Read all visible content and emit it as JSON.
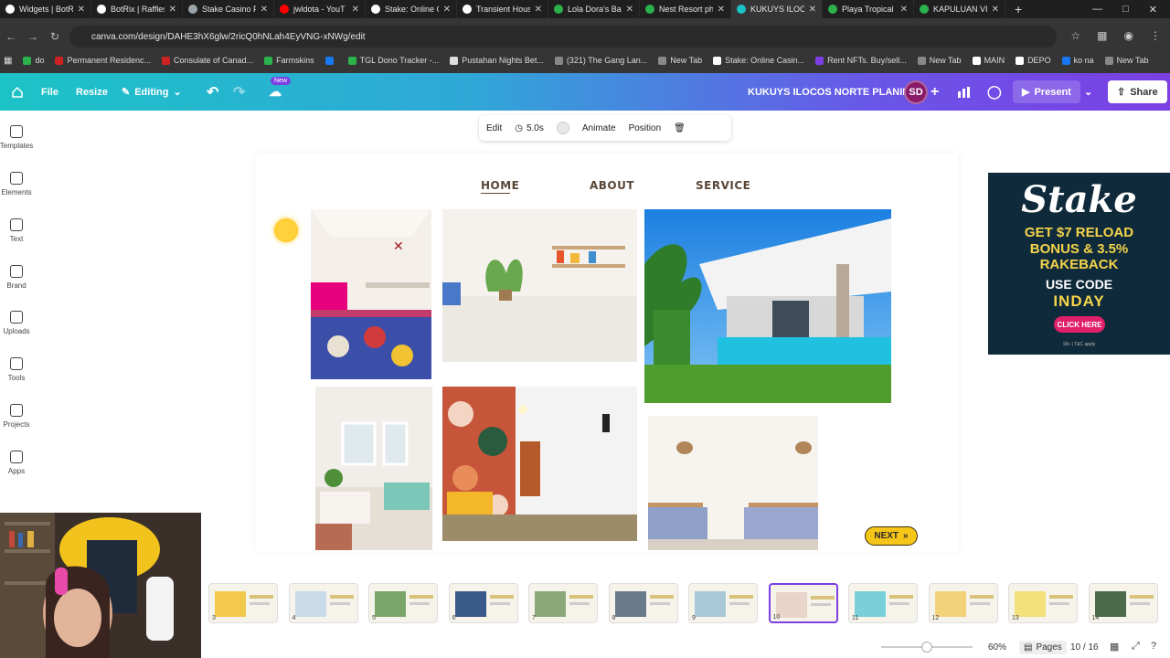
{
  "browser": {
    "tabs": [
      {
        "title": "Widgets | BotR",
        "color": "#ffffff"
      },
      {
        "title": "BotRix | Raffles",
        "color": "#ffffff"
      },
      {
        "title": "Stake Casino P",
        "color": "#9aa4a8"
      },
      {
        "title": "jwldota - YouT",
        "color": "#ff0000"
      },
      {
        "title": "Stake: Online C",
        "color": "#ffffff"
      },
      {
        "title": "Transient Hous",
        "color": "#ffffff"
      },
      {
        "title": "Lola Dora's Ba",
        "color": "#2bb24c"
      },
      {
        "title": "Nest Resort ph",
        "color": "#2bb24c"
      },
      {
        "title": "KUKUYS ILOCO",
        "color": "#1cc3c6"
      },
      {
        "title": "Playa Tropical",
        "color": "#2bb24c"
      },
      {
        "title": "KAPULUAN VI",
        "color": "#2bb24c"
      }
    ],
    "active_tab_index": 8,
    "url": "canva.com/design/DAHE3hX6glw/2ricQ0hNLah4EyVNG-xNWg/edit",
    "bookmarks": [
      {
        "label": "do",
        "color": "#2bb24c"
      },
      {
        "label": "Permanent Residenc...",
        "color": "#cc2222"
      },
      {
        "label": "Consulate of Canad...",
        "color": "#cc2222"
      },
      {
        "label": "Farmskins",
        "color": "#2bb24c"
      },
      {
        "label": "",
        "color": "#1877f2"
      },
      {
        "label": "TGL Dono Tracker -...",
        "color": "#2bb24c"
      },
      {
        "label": "Pustahan Nights Bet...",
        "color": "#dddddd"
      },
      {
        "label": "(321) The Gang Lan...",
        "color": "#888888"
      },
      {
        "label": "New Tab",
        "color": "#888888"
      },
      {
        "label": "Stake: Online Casin...",
        "color": "#ffffff"
      },
      {
        "label": "Rent NFTs. Buy/sell...",
        "color": "#7b3fe4"
      },
      {
        "label": "New Tab",
        "color": "#888888"
      },
      {
        "label": "MAIN",
        "color": "#ffffff"
      },
      {
        "label": "DEPO",
        "color": "#ffffff"
      },
      {
        "label": "ko na",
        "color": "#1877f2"
      },
      {
        "label": "New Tab",
        "color": "#888888"
      }
    ]
  },
  "canva": {
    "menu": {
      "file": "File",
      "resize": "Resize",
      "editing": "Editing"
    },
    "new_badge": "New",
    "design_title": "KUKUYS ILOCOS NORTE PLANING",
    "avatar_initials": "SD",
    "present_label": "Present",
    "share_label": "Share",
    "sidebar": [
      {
        "label": "Templates"
      },
      {
        "label": "Elements"
      },
      {
        "label": "Text"
      },
      {
        "label": "Brand"
      },
      {
        "label": "Uploads"
      },
      {
        "label": "Tools"
      },
      {
        "label": "Projects"
      },
      {
        "label": "Apps"
      }
    ],
    "toolbar": {
      "edit": "Edit",
      "duration": "5.0s",
      "animate": "Animate",
      "position": "Position"
    },
    "page": {
      "nav": {
        "home": "HOME",
        "about": "ABOUT",
        "service": "SERVICE"
      },
      "next_label": "NEXT"
    },
    "thumbnails": [
      {
        "num": "3"
      },
      {
        "num": "4"
      },
      {
        "num": "5"
      },
      {
        "num": "6"
      },
      {
        "num": "7"
      },
      {
        "num": "8"
      },
      {
        "num": "9"
      },
      {
        "num": "10"
      },
      {
        "num": "11"
      },
      {
        "num": "12"
      },
      {
        "num": "13"
      },
      {
        "num": "14"
      }
    ],
    "selected_thumb_index": 7,
    "bottom": {
      "zoom": "60%",
      "pages_label": "Pages",
      "page_counter": "10 / 16"
    }
  },
  "ad": {
    "logo": "Stake",
    "line1": "GET $7 RELOAD",
    "line2": "BONUS & 3.5%",
    "line3": "RAKEBACK",
    "code_label": "USE CODE",
    "code": "INDAY",
    "button": "CLICK HERE",
    "fine_print": "18+ | T&C apply"
  }
}
